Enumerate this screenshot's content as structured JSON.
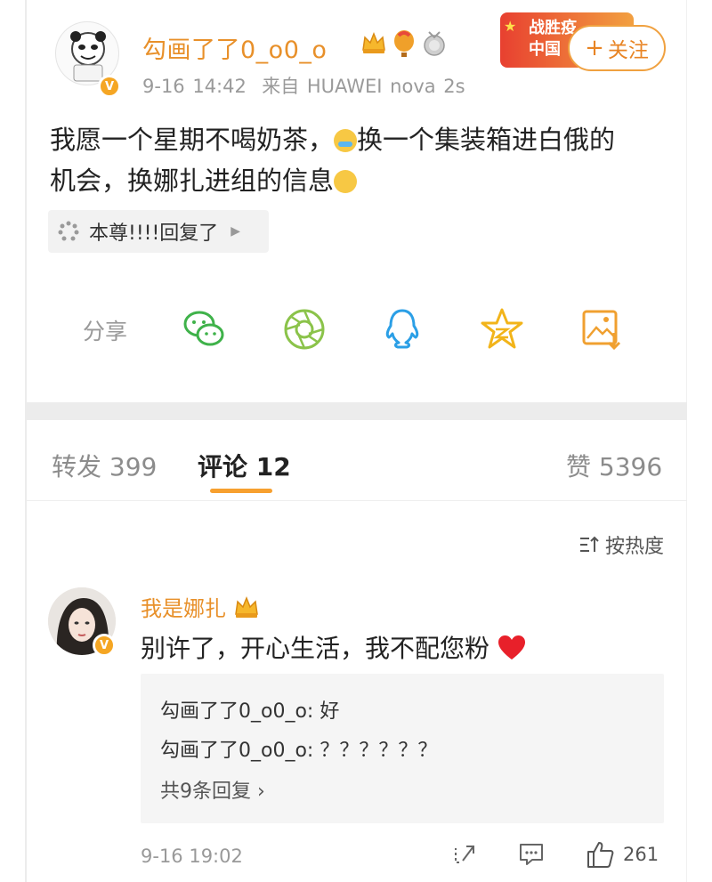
{
  "post": {
    "username": "勾画了了0_o0_o",
    "time": "9-16 14:42",
    "source": "来自 HUAWEI nova 2s",
    "text_line1": "我愿一个星期不喝奶茶，",
    "text_line1b": "换一个集装箱进白俄的",
    "text_line2": "机会，换娜扎进组的信息",
    "reply_chip": "本尊!!!!回复了",
    "promo_text": "战胜疫 中国",
    "follow_label": "关注"
  },
  "share": {
    "label": "分享",
    "icons": [
      "wechat-icon",
      "moments-icon",
      "qq-icon",
      "qzone-icon",
      "save-image-icon"
    ]
  },
  "tabs": {
    "repost": "转发 399",
    "comments": "评论 12",
    "likes": "赞 5396"
  },
  "sort": {
    "label": "按热度"
  },
  "comment": {
    "username": "我是娜扎",
    "text": "别许了，开心生活，我不配您粉",
    "replies": [
      "勾画了了0_o0_o: 好",
      "勾画了了0_o0_o: ？？？？？？"
    ],
    "more_replies": "共9条回复 ›",
    "time": "9-16 19:02",
    "like_count": "261"
  },
  "colors": {
    "accent_orange": "#e8902a",
    "tab_underline": "#f7a02f",
    "vip_badge": "#f5a623"
  }
}
